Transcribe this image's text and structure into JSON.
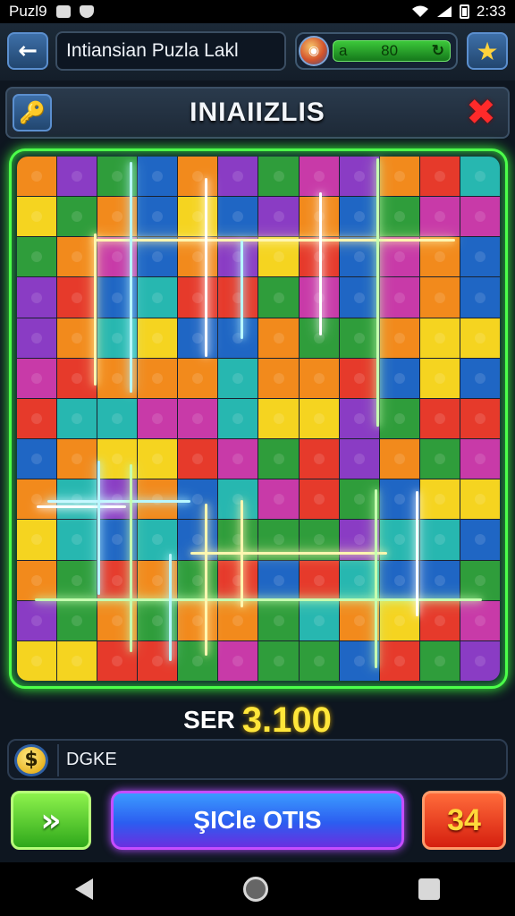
{
  "status_bar": {
    "app_name": "Puzl9",
    "time": "2:33"
  },
  "header": {
    "title": "Intiansian Puzla Lakl",
    "coin_left": "a",
    "coin_value": "80",
    "refresh_symbol": "↻",
    "icons": {
      "back": "arrow-left-icon",
      "star": "star-icon",
      "emblem": "globe-emblem-icon"
    }
  },
  "panel": {
    "title": "INIAIIZLIS",
    "icons": {
      "left": "key-icon",
      "right": "close-icon"
    }
  },
  "board": {
    "columns": 12,
    "rows": 13,
    "palette": [
      "#2f9d3b",
      "#1f66c4",
      "#e63a2b",
      "#f28a1c",
      "#8a3cc4",
      "#f5d420",
      "#27b7b0",
      "#c83aa8"
    ],
    "glow_colors": [
      "#fff6b0",
      "#b8f7ff",
      "#ffffff",
      "#c6ffb0"
    ]
  },
  "score": {
    "prefix": "SER",
    "value": "3.100"
  },
  "currency_bar": {
    "symbol": "$",
    "text": "DGKE"
  },
  "buttons": {
    "next_symbol": "»",
    "cycle_label": "ŞICle OTIS",
    "moves_value": "34"
  },
  "colors": {
    "board_border": "#4cff4a",
    "accent_blue": "#2c5df0",
    "accent_purple": "#c64dff",
    "score_yellow": "#ffe63a",
    "close_red": "#ff2a2a"
  }
}
